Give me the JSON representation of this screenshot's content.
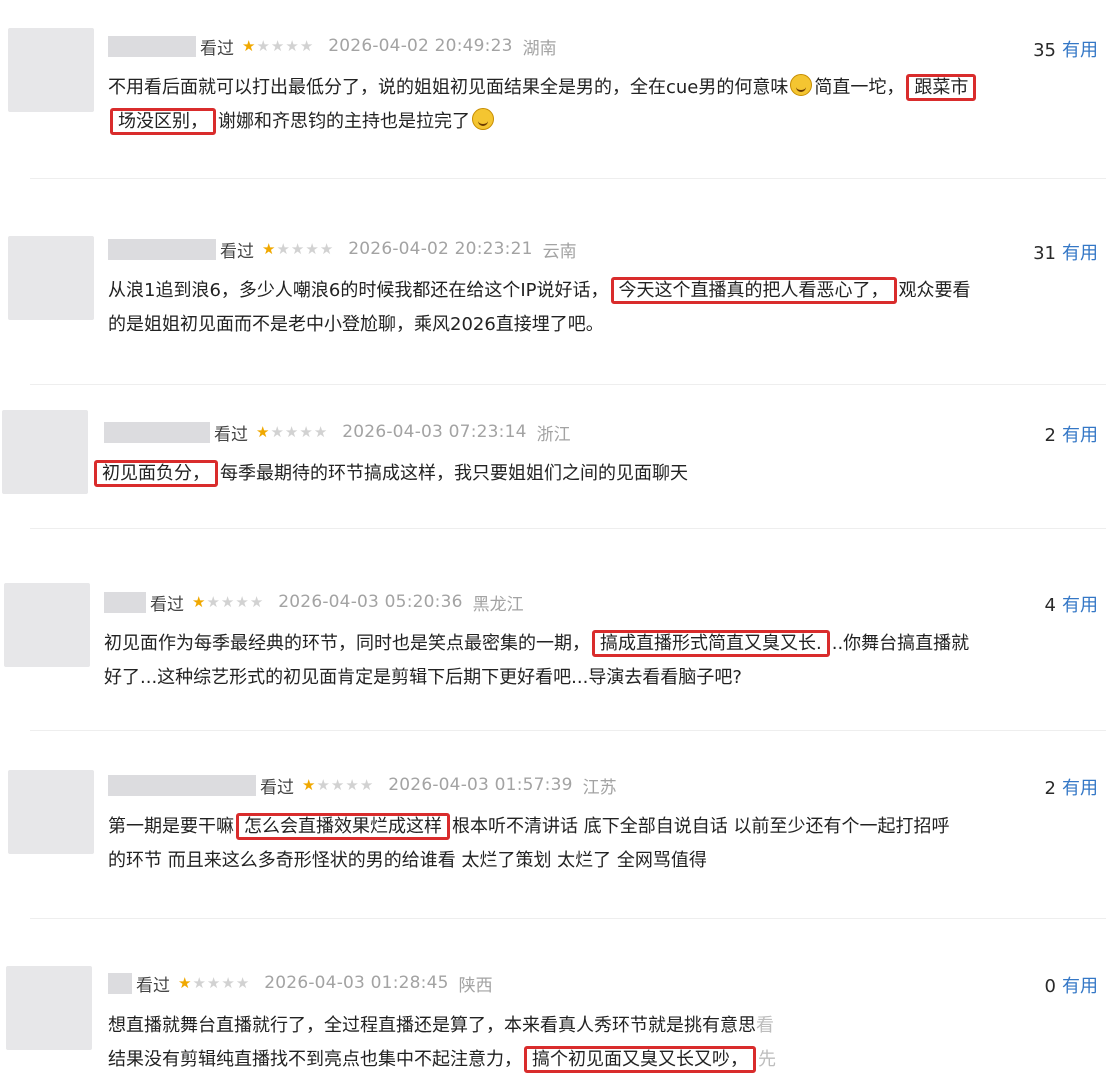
{
  "reviews": [
    {
      "seen": "看过",
      "rating": 1,
      "time": "2026-04-02 20:49:23",
      "location": "湖南",
      "useful_count": "35",
      "useful_label": "有用",
      "segments": [
        {
          "text": "不用看后面就可以打出最低分了，说的姐姐初见面结果全是男的，全在cue男的何意味"
        },
        {
          "emoji": "laugh-emoji"
        },
        {
          "text": "简直一坨，"
        },
        {
          "text": "跟菜市",
          "hl": true
        },
        {
          "br": true
        },
        {
          "text": "场没区别，",
          "hl": true
        },
        {
          "text": "谢娜和齐思钧的主持也是拉完了"
        },
        {
          "emoji": "smile-emoji"
        }
      ]
    },
    {
      "seen": "看过",
      "rating": 1,
      "time": "2026-04-02 20:23:21",
      "location": "云南",
      "useful_count": "31",
      "useful_label": "有用",
      "segments": [
        {
          "text": "从浪1追到浪6，多少人嘲浪6的时候我都还在给这个IP说好话，"
        },
        {
          "text": "今天这个直播真的把人看恶心了，",
          "hl": true
        },
        {
          "text": "观众要看"
        },
        {
          "br": true
        },
        {
          "text": "的是姐姐初见面而不是老中小登尬聊，乘风2026直接埋了吧。"
        }
      ]
    },
    {
      "seen": "看过",
      "rating": 1,
      "time": "2026-04-03 07:23:14",
      "location": "浙江",
      "useful_count": "2",
      "useful_label": "有用",
      "segments": [
        {
          "text": "初见面负分，",
          "hl": true
        },
        {
          "text": "每季最期待的环节搞成这样，我只要姐姐们之间的见面聊天"
        }
      ]
    },
    {
      "seen": "看过",
      "rating": 1,
      "time": "2026-04-03 05:20:36",
      "location": "黑龙江",
      "useful_count": "4",
      "useful_label": "有用",
      "segments": [
        {
          "text": "初见面作为每季最经典的环节，同时也是笑点最密集的一期，"
        },
        {
          "text": "搞成直播形式简直又臭又长.",
          "hl": true
        },
        {
          "text": "..你舞台搞直播就"
        },
        {
          "br": true
        },
        {
          "text": "好了...这种综艺形式的初见面肯定是剪辑下后期下更好看吧...导演去看看脑子吧?"
        }
      ]
    },
    {
      "seen": "看过",
      "rating": 1,
      "time": "2026-04-03 01:57:39",
      "location": "江苏",
      "useful_count": "2",
      "useful_label": "有用",
      "segments": [
        {
          "text": "第一期是要干嘛"
        },
        {
          "text": "怎么会直播效果烂成这样",
          "hl": true
        },
        {
          "text": "根本听不清讲话 底下全部自说自话 以前至少还有个一起打招呼"
        },
        {
          "br": true
        },
        {
          "text": "的环节 而且来这么多奇形怪状的男的给谁看 太烂了策划 太烂了 全网骂值得"
        }
      ]
    },
    {
      "seen": "看过",
      "rating": 1,
      "time": "2026-04-03 01:28:45",
      "location": "陕西",
      "useful_count": "0",
      "useful_label": "有用",
      "segments": [
        {
          "text": "想直播就舞台直播就行了，全过程直播还是算了，本来看真人秀环节就是挑有意思"
        },
        {
          "text": "看",
          "fade": true
        },
        {
          "br": true
        },
        {
          "text": "结果没有剪辑纯直播找不到亮点也集中不起注意力，"
        },
        {
          "text": "搞个初见面又臭又长又吵，",
          "hl": true
        },
        {
          "text": "先",
          "fade": true
        }
      ]
    }
  ]
}
